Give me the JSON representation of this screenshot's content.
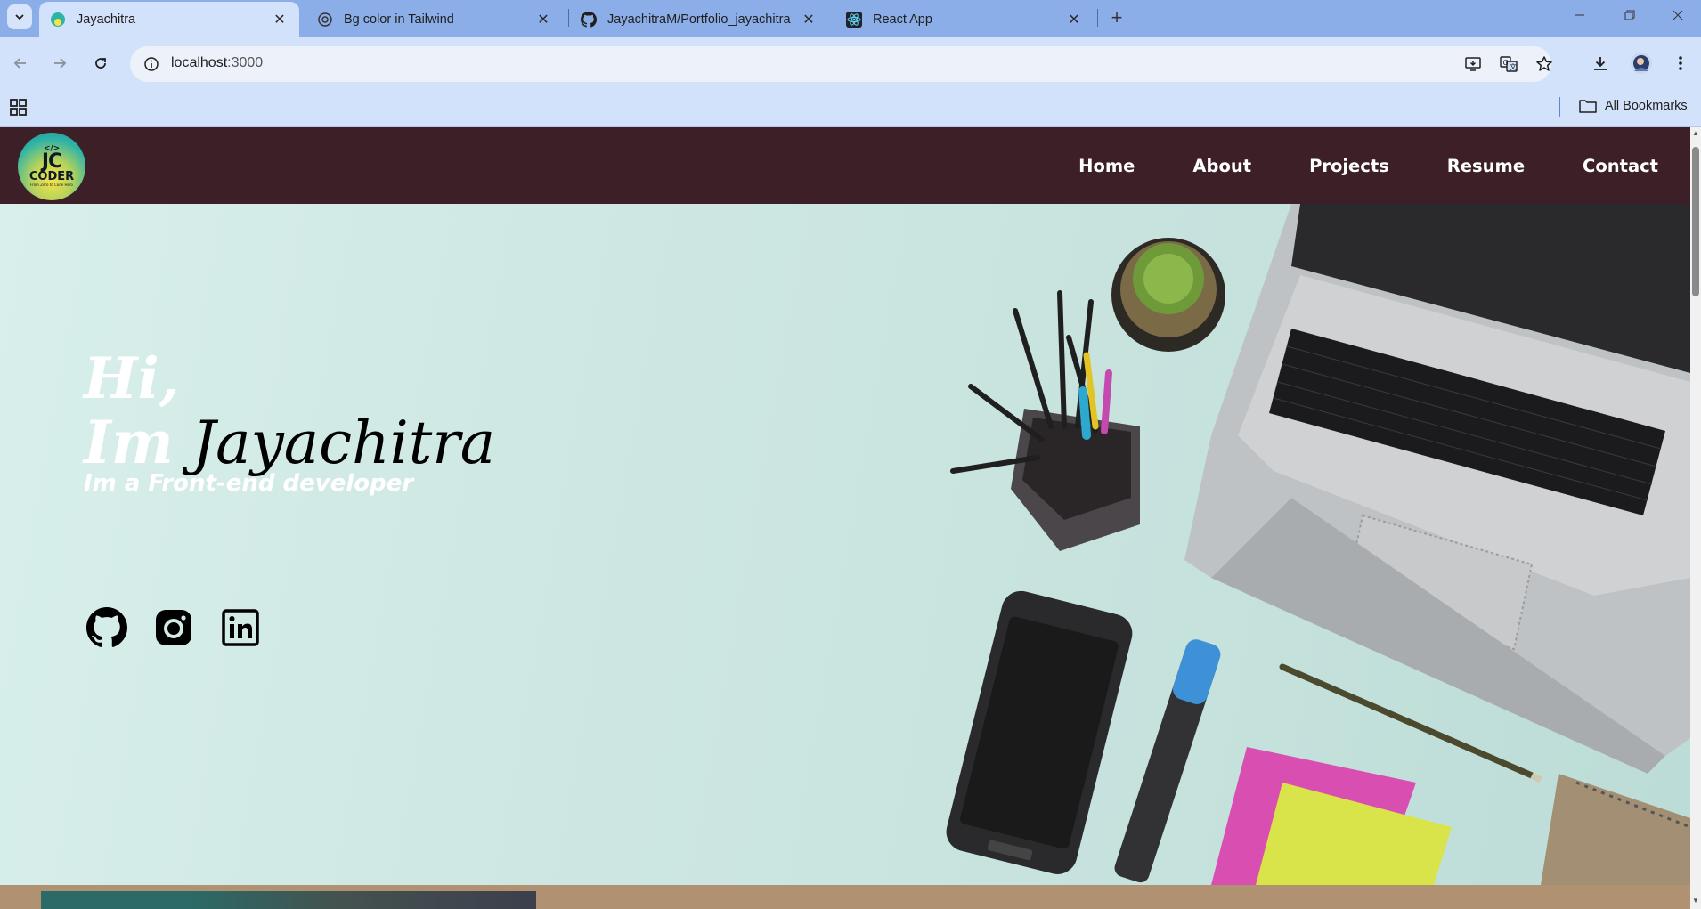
{
  "browser": {
    "tabs": [
      {
        "title": "Jayachitra",
        "icon": "site-favicon",
        "active": true
      },
      {
        "title": "Bg color in Tailwind",
        "icon": "chatgpt-icon",
        "active": false
      },
      {
        "title": "JayachitraM/Portfolio_jayachitra",
        "icon": "github-icon",
        "active": false
      },
      {
        "title": "React App",
        "icon": "react-icon",
        "active": false
      }
    ],
    "url_host": "localhost",
    "url_port": ":3000",
    "bookmarks_label": "All Bookmarks"
  },
  "site": {
    "logo": {
      "code": "</>",
      "initials": "JC",
      "word": "CODER",
      "tagline": "From Zero to Code Hero"
    },
    "nav": [
      "Home",
      "About",
      "Projects",
      "Resume",
      "Contact"
    ],
    "hero": {
      "greeting": "Hi,",
      "im": "Im",
      "name": "Jayachitra",
      "role": "Im a Front-end developer"
    },
    "socials": [
      "github-icon",
      "instagram-icon",
      "linkedin-icon"
    ]
  },
  "colors": {
    "nav_bg": "#3d1f27",
    "hero_bg": "#cfe7e3",
    "chrome_tabbar": "#8caee8",
    "chrome_toolbar": "#d3e2fb"
  }
}
